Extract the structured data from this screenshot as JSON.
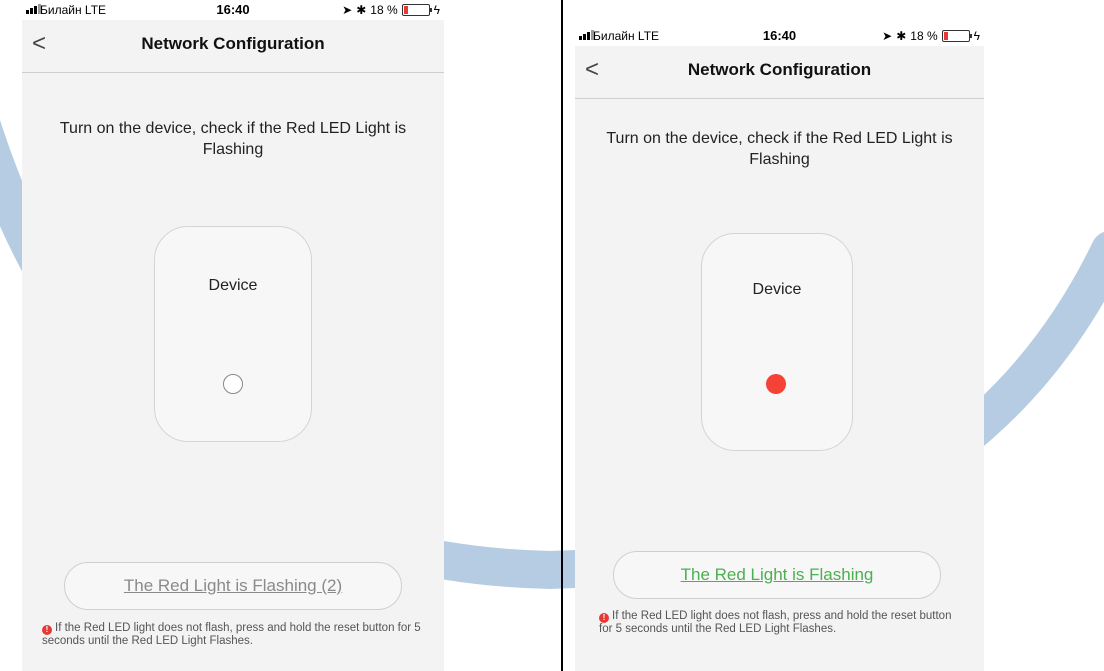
{
  "left_screen": {
    "status": {
      "carrier": "Билайн  LTE",
      "time": "16:40",
      "battery": "18 %",
      "battery_level": 0.18
    },
    "nav": {
      "back_glyph": "<",
      "title": "Network Configuration"
    },
    "instruction": "Turn on the device, check if the Red LED Light is Flashing",
    "device_label": "Device",
    "led_state": "off",
    "button_label": "The Red Light is Flashing (2)",
    "hint": "If the Red LED light does not flash, press and hold the reset button for 5 seconds until the Red LED Light Flashes."
  },
  "right_screen": {
    "status": {
      "carrier": "Билайн  LTE",
      "time": "16:40",
      "battery": "18 %",
      "battery_level": 0.18
    },
    "nav": {
      "back_glyph": "<",
      "title": "Network Configuration"
    },
    "instruction": "Turn on the device, check if the Red LED Light is Flashing",
    "device_label": "Device",
    "led_state": "on",
    "button_label": "The Red Light is Flashing",
    "hint": "If the Red LED light does not flash, press and hold the reset button for 5 seconds until the Red LED Light Flashes."
  },
  "colors": {
    "led_on": "#f44336",
    "button_disabled_text": "#8a8a8a",
    "button_enabled_text": "#4caf50",
    "watermark": "#a9c3dd"
  }
}
